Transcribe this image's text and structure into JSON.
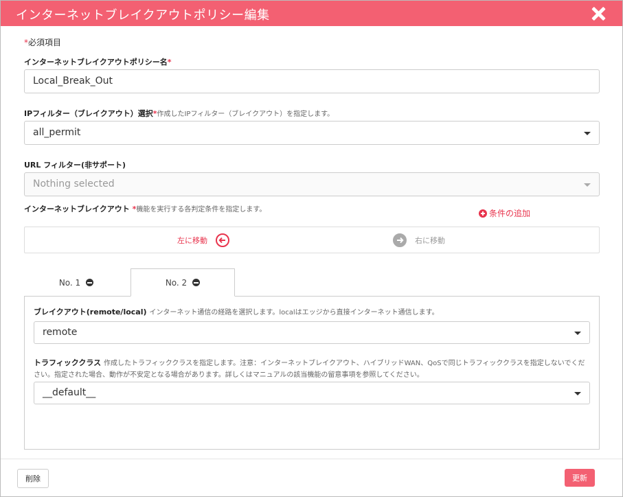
{
  "modal": {
    "title": "インターネットブレイクアウトポリシー編集",
    "required_mark": "*",
    "required_note": "必須項目"
  },
  "policy_name": {
    "label": "インターネットブレイクアウトポリシー名",
    "value": "Local_Break_Out"
  },
  "ip_filter": {
    "label": "IPフィルター（ブレイクアウト）選択",
    "hint": "作成したIPフィルター（ブレイクアウト）を指定します。",
    "value": "all_permit"
  },
  "url_filter": {
    "label": "URL フィルター(非サポート)",
    "placeholder": "Nothing selected"
  },
  "breakout": {
    "label": "インターネットブレイクアウト",
    "hint": "機能を実行する各判定条件を指定します。",
    "add_condition": "条件の追加",
    "move_left": "左に移動",
    "move_right": "右に移動"
  },
  "tabs": [
    {
      "label": "No. 1"
    },
    {
      "label": "No. 2"
    }
  ],
  "panel": {
    "breakout_label": "ブレイクアウト(remote/local)",
    "breakout_hint": "インターネット通信の経路を選択します。localはエッジから直接インターネット通信します。",
    "breakout_value": "remote",
    "traffic_label": "トラフィッククラス",
    "traffic_hint": "作成したトラフィッククラスを指定します。注意：インターネットブレイクアウト、ハイブリッドWAN、QoSで同じトラフィッククラスを指定しないでください。指定された場合、動作が不安定となる場合があります。詳しくはマニュアルの該当機能の留意事項を参照してください。",
    "traffic_value": "__default__"
  },
  "footer": {
    "delete": "削除",
    "update": "更新"
  },
  "colors": {
    "accent": "#f36072",
    "required": "#e8344d"
  }
}
